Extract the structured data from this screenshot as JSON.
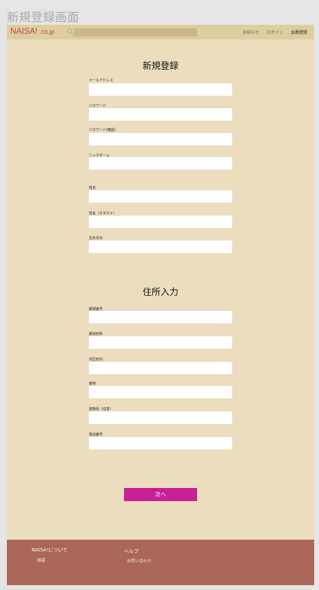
{
  "page_label": "新規登録画面",
  "header": {
    "logo": "NAISA!",
    "logo_domain": ".co.jp",
    "search_placeholder": "",
    "nav": [
      "お知らせ",
      "ログイン",
      "会員登録"
    ]
  },
  "sections": {
    "registration_title": "新規登録",
    "address_title": "住所入力"
  },
  "fields": {
    "email": "メールアドレス",
    "password": "パスワード",
    "password_confirm": "パスワード(確認)",
    "nickname": "ニックネーム",
    "name": "姓名",
    "name_kana": "姓名（カタカナ）",
    "birthdate": "生年月日",
    "postal_code": "郵便番号",
    "prefecture": "都道府県",
    "city": "市区町村",
    "street": "番地",
    "building": "建物名（任意）",
    "phone": "電話番号"
  },
  "next_label": "次へ",
  "footer": {
    "about_title": "NAISA!について",
    "about_link": "概要",
    "help_title": "ヘルプ",
    "help_link": "お問い合わせ"
  },
  "colors": {
    "background": "#ebddbd",
    "header": "#decd9f",
    "accent": "#c81f95",
    "footer": "#aa6657",
    "logo": "#b14a4a"
  }
}
